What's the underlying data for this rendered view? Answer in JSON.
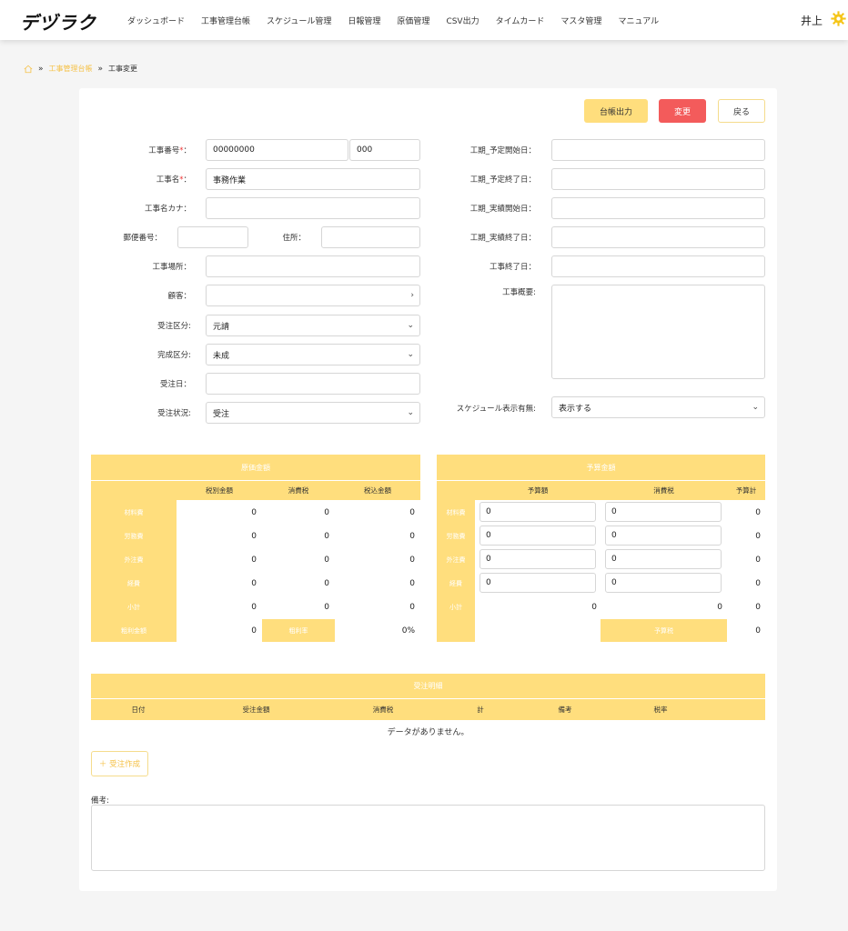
{
  "app": {
    "logo": "デヅラク",
    "user": "井上"
  },
  "nav": [
    "ダッシュボード",
    "工事管理台帳",
    "スケジュール管理",
    "日報管理",
    "原価管理",
    "CSV出力",
    "タイムカード",
    "マスタ管理",
    "マニュアル"
  ],
  "breadcrumb": {
    "sep1": "»",
    "link": "工事管理台帳",
    "sep2": "»",
    "current": "工事変更"
  },
  "toolbar": {
    "ledger_label": "台帳出力",
    "change_label": "変更",
    "back_label": "戻る"
  },
  "form": {
    "project_no_label": "工事番号",
    "project_no_value": "00000000",
    "project_no_sub_value": "000",
    "project_name_label": "工事名",
    "project_name_value": "事務作業",
    "project_kana_label": "工事名カナ：",
    "postal_label": "郵便番号：",
    "address_label": "住所：",
    "site_label": "工事場所：",
    "customer_label": "顧客：",
    "order_type_label": "受注区分:",
    "order_type_value": "元請",
    "completion_label": "完成区分:",
    "completion_value": "未成",
    "order_date_label": "受注日：",
    "order_status_label": "受注状況:",
    "order_status_value": "受注",
    "plan_start_label": "工期_予定開始日：",
    "plan_end_label": "工期_予定終了日：",
    "actual_start_label": "工期_実績開始日：",
    "actual_end_label": "工期_実績終了日：",
    "finish_label": "工事終了日：",
    "summary_label": "工事概要:",
    "schedule_label": "スケジュール表示有無:",
    "schedule_value": "表示する",
    "colon": "："
  },
  "cost": {
    "title": "原価金額",
    "cols": [
      "税別金額",
      "消費税",
      "税込金額"
    ],
    "rows": [
      {
        "label": "材料費",
        "values": [
          "0",
          "0",
          "0"
        ]
      },
      {
        "label": "労務費",
        "values": [
          "0",
          "0",
          "0"
        ]
      },
      {
        "label": "外注費",
        "values": [
          "0",
          "0",
          "0"
        ]
      },
      {
        "label": "経費",
        "values": [
          "0",
          "0",
          "0"
        ]
      },
      {
        "label": "小計",
        "values": [
          "0",
          "0",
          "0"
        ]
      }
    ],
    "profit_label": "粗利金額",
    "profit_value": "0",
    "rate_label": "粗利率",
    "rate_value": "0%"
  },
  "budget": {
    "title": "予算金額",
    "cols": [
      "予算額",
      "消費税",
      "予算計"
    ],
    "rows": [
      {
        "label": "材料費",
        "budget": "0",
        "tax": "0",
        "total": "0"
      },
      {
        "label": "労務費",
        "budget": "0",
        "tax": "0",
        "total": "0"
      },
      {
        "label": "外注費",
        "budget": "0",
        "tax": "0",
        "total": "0"
      },
      {
        "label": "経費",
        "budget": "0",
        "tax": "0",
        "total": "0"
      }
    ],
    "subtotal_label": "小計",
    "subtotal_values": [
      "0",
      "0",
      "0"
    ],
    "budget_tax_label": "予算税",
    "budget_tax_value": "0"
  },
  "orders": {
    "title": "受注明細",
    "cols": [
      "日付",
      "受注金額",
      "消費税",
      "計",
      "備考",
      "税率"
    ],
    "empty": "データがありません。",
    "add_label": "＋ 受注作成"
  },
  "notes": {
    "label": "備考:"
  },
  "colors": {
    "accent": "#ffde7d",
    "danger": "#f35b5b"
  }
}
